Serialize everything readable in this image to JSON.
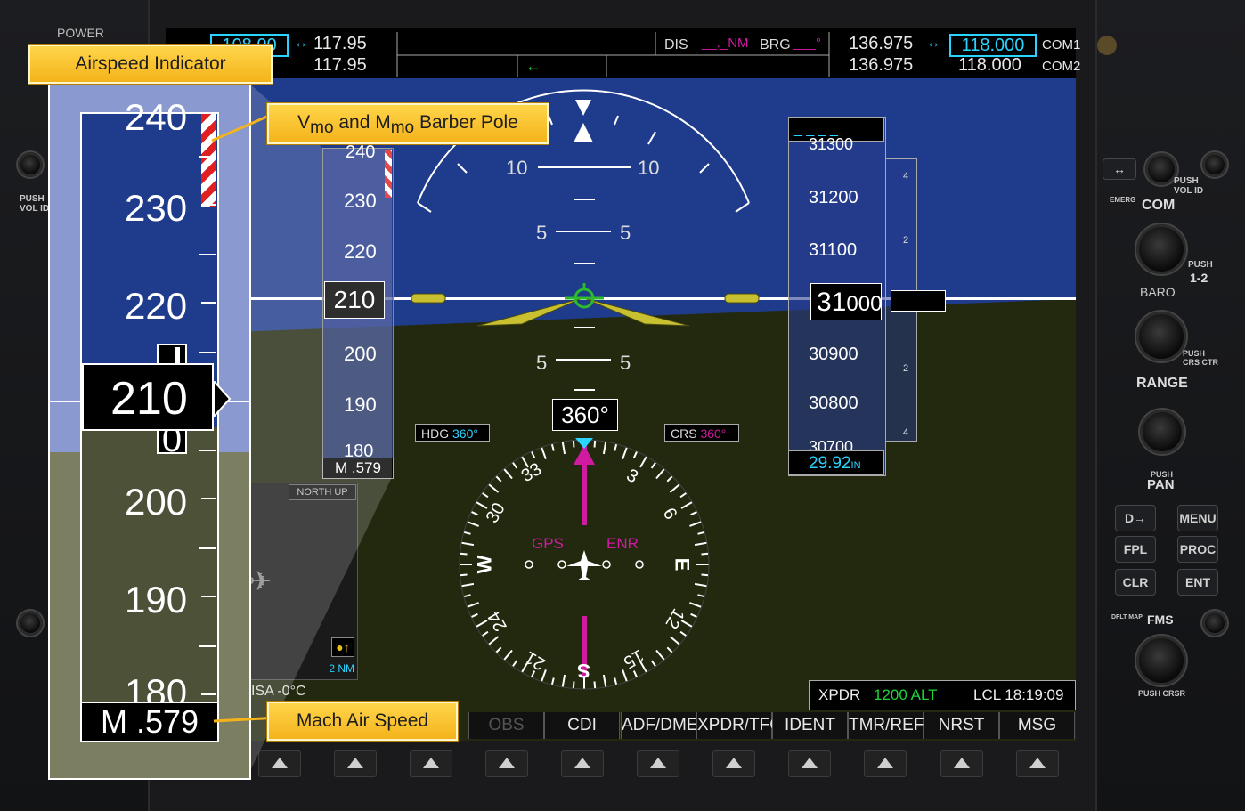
{
  "header": {
    "power_label": "POWER"
  },
  "callouts": {
    "airspeed_indicator": "Airspeed Indicator",
    "barber_pole": {
      "v": "V",
      "mo1": "mo",
      "and": " and M",
      "mo2": "mo",
      "rest": " Barber Pole"
    },
    "mach_air_speed": "Mach Air Speed"
  },
  "nav": {
    "nav1_active": "108.00",
    "nav1_standby": "117.95",
    "nav2_active": "117.95",
    "dis_label": "DIS",
    "dis_value": "__._NM",
    "brg_label": "BRG",
    "brg_value": "___°"
  },
  "com": {
    "com1_active": "136.975",
    "com1_standby": "118.000",
    "com1_label": "COM1",
    "com2_active": "136.975",
    "com2_standby": "118.000",
    "com2_label": "COM2"
  },
  "airspeed": {
    "ticks": [
      "240",
      "230",
      "220",
      "210",
      "200",
      "190",
      "180"
    ],
    "current": "210",
    "current_digit": "0",
    "mach": "M .579"
  },
  "altitude": {
    "selected": "_ _ _ _",
    "ticks_small": [
      "31300",
      "31200",
      "31100",
      "30900",
      "30800",
      "30700"
    ],
    "current_hundreds": "31",
    "current_rest": "000",
    "vsi_marks": [
      "4",
      "2",
      "2",
      "4"
    ],
    "baro": "29.92",
    "baro_unit": "IN"
  },
  "attitude": {
    "pitch_labels": [
      "10",
      "10",
      "5",
      "5",
      "5",
      "5"
    ]
  },
  "hsi": {
    "heading": "360°",
    "hdg_label": "HDG",
    "hdg_value": "360°",
    "crs_label": "CRS",
    "crs_value": "360°",
    "gps_label": "GPS",
    "enr_label": "ENR",
    "cardinals": [
      "33",
      "30",
      "W",
      "24",
      "21",
      "S",
      "15",
      "12",
      "E",
      "6",
      "3"
    ]
  },
  "inset_map": {
    "north_up": "NORTH UP",
    "range": "2 NM",
    "isa": "ISA -0°C"
  },
  "xpdr": {
    "label": "XPDR",
    "code": "1200 ALT",
    "time": "LCL 18:19:09"
  },
  "softkeys": [
    "OBS",
    "CDI",
    "ADF/DME",
    "XPDR/TFC",
    "IDENT",
    "TMR/REF",
    "NRST",
    "MSG"
  ],
  "right_panel": {
    "push_vol_id": "PUSH VOL ID",
    "emerg": "EMERG",
    "com_label": "COM",
    "push_12": "PUSH",
    "onetwo": "1-2",
    "baro_label": "BARO",
    "push_crs_ctr": "PUSH CRS CTR",
    "range_label": "RANGE",
    "push_pan": "PUSH",
    "pan_label": "PAN",
    "buttons": [
      "D→",
      "MENU",
      "FPL",
      "PROC",
      "CLR",
      "ENT"
    ],
    "dflt_map": "DFLT MAP",
    "fms_label": "FMS",
    "push_crsr": "PUSH CRSR"
  },
  "left_panel": {
    "push_vol_id": "PUSH VOL ID"
  },
  "colors": {
    "sky": "#1e3b8c",
    "ground": "#22290f",
    "callout": "#f4b31b",
    "magenta": "#d01aa0",
    "cyan": "#2bd4ff"
  }
}
